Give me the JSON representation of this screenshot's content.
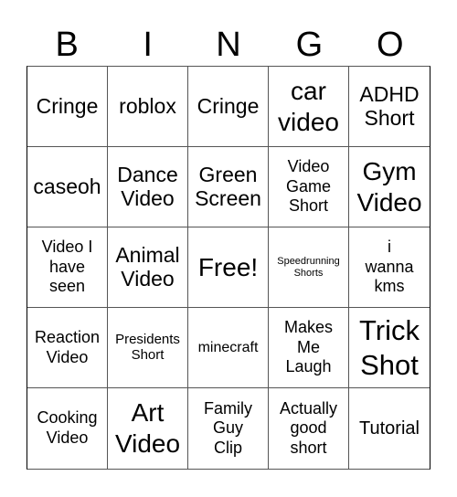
{
  "header": {
    "letters": [
      "B",
      "I",
      "N",
      "G",
      "O"
    ]
  },
  "card": {
    "rows": [
      [
        "Cringe",
        "roblox",
        "Cringe",
        "car video",
        "ADHD Short"
      ],
      [
        "caseoh",
        "Dance Video",
        "Green Screen",
        "Video Game Short",
        "Gym Video"
      ],
      [
        "Video I have seen",
        "Animal Video",
        "Free!",
        "Speedrunning Shorts",
        "i wanna kms"
      ],
      [
        "Reaction Video",
        "Presidents Short",
        "minecraft",
        "Makes Me Laugh",
        "Trick Shot"
      ],
      [
        "Cooking Video",
        "Art Video",
        "Family Guy Clip",
        "Actually good short",
        "Tutorial"
      ]
    ],
    "free_space": "Free!"
  }
}
